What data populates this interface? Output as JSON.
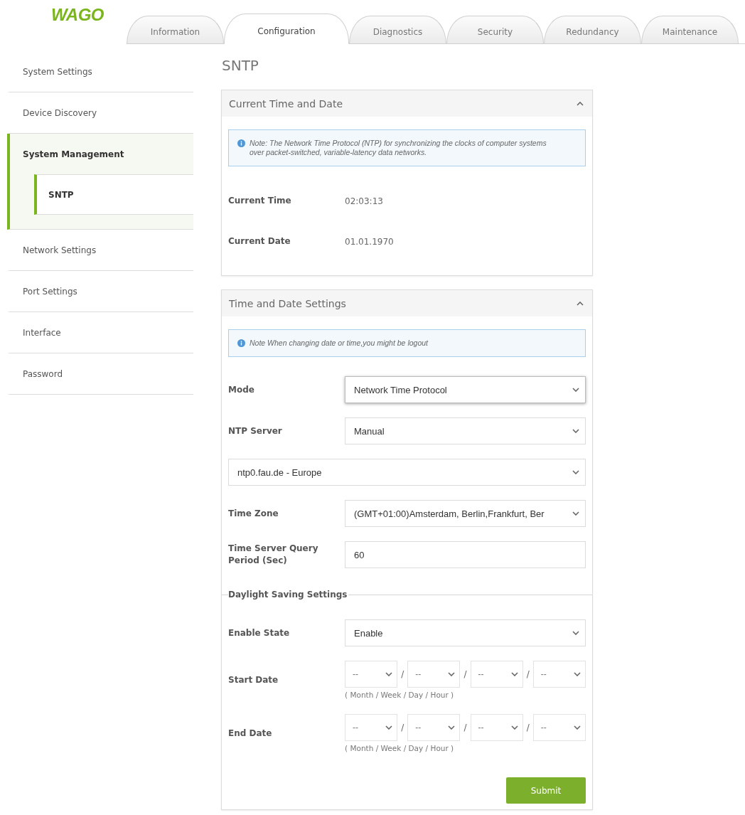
{
  "logo": "WAGO",
  "tabs": [
    {
      "label": "Information",
      "selected": false
    },
    {
      "label": "Configuration",
      "selected": true
    },
    {
      "label": "Diagnostics",
      "selected": false
    },
    {
      "label": "Security",
      "selected": false
    },
    {
      "label": "Redundancy",
      "selected": false
    },
    {
      "label": "Maintenance",
      "selected": false
    }
  ],
  "sidebar": {
    "items": [
      {
        "label": "System Settings",
        "selected": false
      },
      {
        "label": "Device Discovery",
        "selected": false
      },
      {
        "label": "System Management",
        "selected": true,
        "expanded": true,
        "children": [
          {
            "label": "SNTP",
            "selected": true
          }
        ]
      },
      {
        "label": "Network Settings",
        "selected": false
      },
      {
        "label": "Port Settings",
        "selected": false
      },
      {
        "label": "Interface",
        "selected": false
      },
      {
        "label": "Password",
        "selected": false
      }
    ]
  },
  "page_title": "SNTP",
  "panels": [
    {
      "title": "Current Time and Date",
      "expanded": true,
      "note": "Note: The Network Time Protocol (NTP) for synchronizing the clocks of computer systems over packet-switched, variable-latency data networks.",
      "fields": [
        {
          "kind": "readout",
          "label": "Current Time",
          "value": "02:03:13"
        },
        {
          "kind": "readout",
          "label": "Current Date",
          "value": "01.01.1970"
        }
      ]
    },
    {
      "title": "Time and Date Settings",
      "expanded": true,
      "note": "Note When changing date or time,you might be logout",
      "fields": [
        {
          "kind": "select",
          "label": "Mode",
          "value": "Network Time Protocol",
          "focused": true
        },
        {
          "kind": "select",
          "label": "NTP Server",
          "value": "Manual",
          "focused": false
        },
        {
          "kind": "wide-select",
          "value": "ntp0.fau.de - Europe",
          "focused": false
        },
        {
          "kind": "select",
          "label": "Time Zone",
          "value": "(GMT+01:00)Amsterdam, Berlin,Frankfurt, Ber",
          "focused": false
        },
        {
          "kind": "input",
          "label": "Time Server Query Period (Sec)",
          "value": "60"
        },
        {
          "kind": "legend",
          "label": "Daylight Saving Settings"
        },
        {
          "kind": "select",
          "label": "Enable State",
          "value": "Enable",
          "focused": false
        },
        {
          "kind": "date-parts",
          "label": "Start Date",
          "parts": [
            "--",
            "--",
            "--",
            "--"
          ],
          "separators": [
            "/",
            "/",
            "/"
          ],
          "caption": "( Month / Week / Day / Hour )"
        },
        {
          "kind": "date-parts",
          "label": "End Date",
          "parts": [
            "--",
            "--",
            "--",
            "--"
          ],
          "separators": [
            "/",
            "/",
            "/"
          ],
          "caption": "( Month / Week / Day / Hour )"
        }
      ],
      "submit": "Submit"
    }
  ]
}
